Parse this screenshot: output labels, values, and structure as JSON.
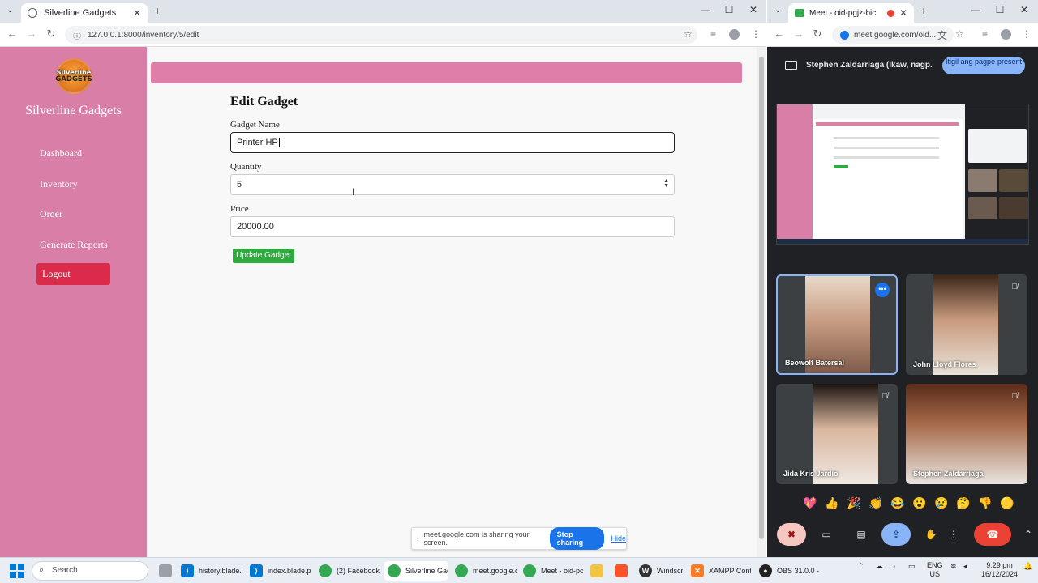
{
  "left_browser": {
    "tab_title": "Silverline Gadgets",
    "url": "127.0.0.1:8000/inventory/5/edit",
    "new_tab": "+",
    "close": "✕"
  },
  "app": {
    "brand": "Silverline Gadgets",
    "logo_top": "Silverline",
    "logo_bottom": "GADGETS",
    "nav": [
      {
        "label": "Dashboard"
      },
      {
        "label": "Inventory"
      },
      {
        "label": "Order"
      },
      {
        "label": "Generate Reports"
      }
    ],
    "logout_label": "Logout",
    "form": {
      "title": "Edit Gadget",
      "name_label": "Gadget Name",
      "name_value": "Printer HP",
      "quantity_label": "Quantity",
      "quantity_value": "5",
      "price_label": "Price",
      "price_value": "20000.00",
      "submit_label": "Update Gadget"
    },
    "colors": {
      "sidebar": "#d97ea6",
      "logout": "#dc2a4a",
      "submit": "#2eaa3f"
    }
  },
  "share_notice": {
    "text": "meet.google.com is sharing your screen.",
    "stop_label": "Stop sharing",
    "hide_label": "Hide"
  },
  "right_browser": {
    "tab_title": "Meet - oid-pgjz-bic",
    "url": "meet.google.com/oid...",
    "presenting_text": "Stephen Zaldarriaga (Ikaw, nagp...",
    "stop_present_label": "Itigil ang pagpe-present",
    "participants": [
      {
        "name": "Beowolf Batersal"
      },
      {
        "name": "John Lloyd Flores"
      },
      {
        "name": "Jida Kris Jardio"
      },
      {
        "name": "Stephen Zaldarriaga"
      }
    ],
    "reactions": [
      "💖",
      "👍",
      "🎉",
      "👏",
      "😂",
      "😮",
      "😢",
      "🤔",
      "👎",
      "🟡"
    ]
  },
  "taskbar": {
    "search_placeholder": "Search",
    "items": [
      {
        "label": "history.blade.p"
      },
      {
        "label": "index.blade.pl"
      },
      {
        "label": "(2) Facebook -"
      },
      {
        "label": "Silverline Gad"
      },
      {
        "label": "meet.google.c"
      },
      {
        "label": "Meet - oid-pc"
      },
      {
        "label": "Windscr"
      },
      {
        "label": "XAMPP Contr"
      },
      {
        "label": "OBS 31.0.0 - P"
      }
    ],
    "lang_top": "ENG",
    "lang_bottom": "US",
    "time": "9:29 pm",
    "date": "16/12/2024"
  }
}
